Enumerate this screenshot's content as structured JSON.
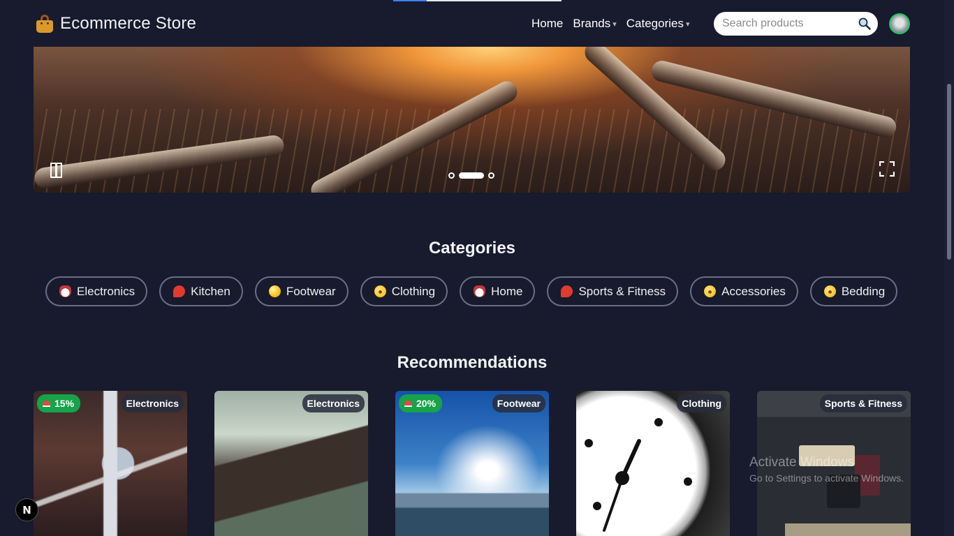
{
  "header": {
    "title": "Ecommerce Store",
    "logo_icon": "shopping-bag-icon",
    "nav": [
      {
        "label": "Home",
        "has_caret": false
      },
      {
        "label": "Brands",
        "has_caret": true
      },
      {
        "label": "Categories",
        "has_caret": true
      }
    ],
    "caret_glyph": "▾",
    "search": {
      "placeholder": "Search products",
      "value": ""
    }
  },
  "hero": {
    "slide_count": 3,
    "active_slide": 2
  },
  "categories": {
    "title": "Categories",
    "items": [
      {
        "label": "Electronics",
        "icon": "robot-icon"
      },
      {
        "label": "Kitchen",
        "icon": "ping-pong-icon"
      },
      {
        "label": "Footwear",
        "icon": "softball-icon"
      },
      {
        "label": "Clothing",
        "icon": "nerd-face-icon"
      },
      {
        "label": "Home",
        "icon": "robot-icon"
      },
      {
        "label": "Sports & Fitness",
        "icon": "ping-pong-icon"
      },
      {
        "label": "Accessories",
        "icon": "nerd-face-icon"
      },
      {
        "label": "Bedding",
        "icon": "nerd-face-icon"
      }
    ]
  },
  "recommendations": {
    "title": "Recommendations",
    "products": [
      {
        "category": "Electronics",
        "discount": "15%"
      },
      {
        "category": "Electronics",
        "discount": ""
      },
      {
        "category": "Footwear",
        "discount": "20%"
      },
      {
        "category": "Clothing",
        "discount": ""
      },
      {
        "category": "Sports & Fitness",
        "discount": ""
      }
    ]
  },
  "watermark": {
    "line1": "Activate Windows",
    "line2": "Go to Settings to activate Windows."
  },
  "dev_badge": "N",
  "colors": {
    "background": "#181a2e",
    "discount_badge": "#16a34a",
    "avatar_ring": "#22c55e"
  }
}
